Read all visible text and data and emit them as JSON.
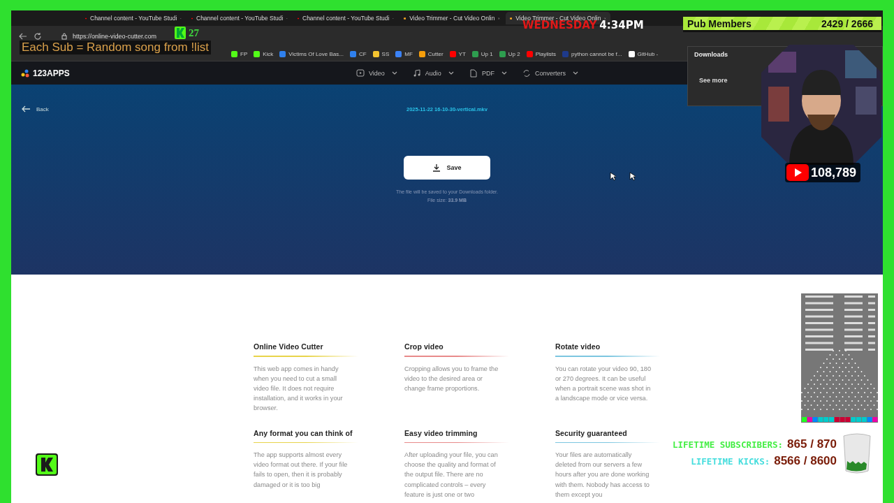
{
  "browser": {
    "tabs": [
      {
        "title": "Channel content - YouTube Studi",
        "selected": false
      },
      {
        "title": "Channel content - YouTube Studi",
        "selected": false
      },
      {
        "title": "Channel content - YouTube Studi",
        "selected": false
      },
      {
        "title": "Video Trimmer - Cut Video Onlin",
        "selected": false
      },
      {
        "title": "Video Trimmer - Cut Video Onlin",
        "selected": true
      }
    ],
    "url": "https://online-video-cutter.com",
    "bookmarks": [
      {
        "label": "FP",
        "color": "#53fc18"
      },
      {
        "label": "Kick",
        "color": "#53fc18"
      },
      {
        "label": "Victims Of Love Bas...",
        "color": "#2f80ed"
      },
      {
        "label": "CF",
        "color": "#2f80ed"
      },
      {
        "label": "SS",
        "color": "#f4c430"
      },
      {
        "label": "MF",
        "color": "#3b82f6"
      },
      {
        "label": "Cutter",
        "color": "#f59e0b"
      },
      {
        "label": "YT",
        "color": "#ff0000"
      },
      {
        "label": "Up 1",
        "color": "#2e9e4f"
      },
      {
        "label": "Up 2",
        "color": "#2e9e4f"
      },
      {
        "label": "Playlists",
        "color": "#ff0000"
      },
      {
        "label": "python cannot be f...",
        "color": "#1e3a8a"
      },
      {
        "label": "GitHub -",
        "color": "#ffffff"
      }
    ],
    "downloads": {
      "title": "Downloads",
      "link": "See more"
    }
  },
  "site": {
    "logo": "123APPS",
    "nav": [
      "Video",
      "Audio",
      "PDF",
      "Converters"
    ],
    "back": "Back",
    "filename": "2025-11-22 16-10-30-vertical.mkv",
    "save": "Save",
    "note": "The file will be saved to your Downloads folder.",
    "size_label": "File size:",
    "size": "33.9 MB",
    "features": [
      {
        "title": "Online Video Cutter",
        "text": "This web app comes in handy when you need to cut a small video file. It does not require installation, and it works in your browser.",
        "color": "#e8d44a"
      },
      {
        "title": "Crop video",
        "text": "Cropping allows you to frame the video to the desired area or change frame proportions.",
        "color": "#e88a8a"
      },
      {
        "title": "Rotate video",
        "text": "You can rotate your video 90, 180 or 270 degrees. It can be useful when a portrait scene was shot in a landscape mode or vice versa.",
        "color": "#7cc6e0"
      },
      {
        "title": "Any format you can think of",
        "text": "The app supports almost every video format out there. If your file fails to open, then it is probably damaged or it is too big",
        "color": "#e8d44a"
      },
      {
        "title": "Easy video trimming",
        "text": "After uploading your file, you can choose the quality and format of the output file. There are no complicated controls – every feature is just one or two",
        "color": "#e88a8a"
      },
      {
        "title": "Security guaranteed",
        "text": "Your files are automatically deleted from our servers a few hours after you are done working with them. Nobody has access to them except you",
        "color": "#7cc6e0"
      }
    ]
  },
  "stream_overlay": {
    "banner": "Each Sub = Random song from !list",
    "kick_count": "27",
    "day": "WEDNESDAY",
    "time": "4:34PM",
    "members_label": "Pub Members",
    "members_count": "2429 / 2666",
    "youtube_subs": "108,789",
    "lifetime": [
      {
        "label": "LIFETIME SUBSCRIBERS:",
        "value": "865 / 870",
        "color": "#44ee44"
      },
      {
        "label": "LIFETIME KICKS:",
        "value": "8566 / 8600",
        "color": "#44dddd"
      }
    ]
  }
}
